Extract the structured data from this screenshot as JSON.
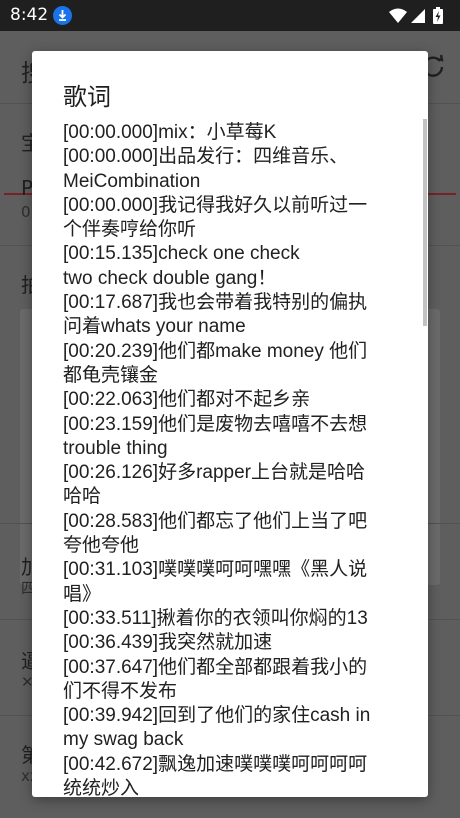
{
  "status_bar": {
    "time": "8:42",
    "download_icon": "download-arrow-icon",
    "wifi_icon": "wifi-icon",
    "signal_icon": "signal-icon",
    "battery_icon": "battery-charging-icon"
  },
  "background": {
    "title_char": "搜",
    "tab_char": "宝",
    "item1_title": "P",
    "item1_sub": "0",
    "item2_title": "拍",
    "item3_title": "加",
    "item3_sub": "四",
    "item4_title": "逼",
    "item4_sub": "✕",
    "item5_title": "第",
    "item5_sub": "xx",
    "refresh_icon": "refresh-icon"
  },
  "dialog": {
    "title": "歌词",
    "lyrics": [
      "[00:00.000]mix：小草莓K",
      "[00:00.000]出品发行：四维音乐、",
      "MeiCombination",
      "[00:00.000]我记得我好久以前听过一",
      "个伴奏哼给你听",
      "[00:15.135]check one check",
      "two check double gang！",
      "[00:17.687]我也会带着我特别的偏执",
      "问着whats your name",
      "[00:20.239]他们都make money 他们",
      "都龟壳镶金",
      "[00:22.063]他们都对不起乡亲",
      "[00:23.159]他们是废物去嘻嘻不去想",
      "trouble thing",
      "[00:26.126]好多rapper上台就是哈哈",
      "哈哈",
      "[00:28.583]他们都忘了他们上当了吧",
      "夸他夸他",
      "[00:31.103]噗噗噗呵呵嘿嘿《黑人说",
      "唱》",
      "[00:33.511]揪着你的衣领叫你焖的13",
      "[00:36.439]我突然就加速",
      "[00:37.647]他们都全部都跟着我小的",
      "们不得不发布",
      "[00:39.942]回到了他们的家住cash in",
      "my swag back",
      "[00:42.672]飘逸加速噗噗噗呵呵呵呵",
      "统统炒入"
    ]
  }
}
